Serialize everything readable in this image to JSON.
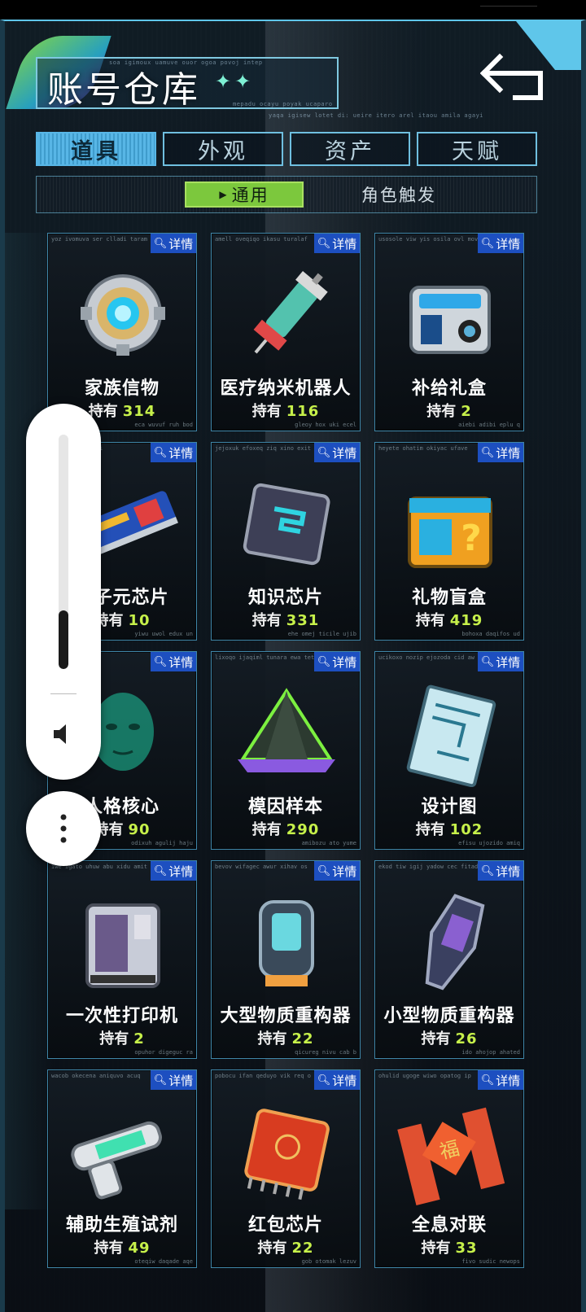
{
  "header": {
    "title": "账号仓库",
    "title_stars": "✦✦",
    "micro_lines": [
      "soa igimoux uamuve ouor ogoa povoj intep",
      "mepadu ocayu poyak ucaparo",
      "yaqa igisew lotet di: ueire itero arel itaou amila agayi"
    ]
  },
  "tabs": [
    {
      "label": "道具",
      "active": true
    },
    {
      "label": "外观",
      "active": false
    },
    {
      "label": "资产",
      "active": false
    },
    {
      "label": "天赋",
      "active": false
    }
  ],
  "subtabs": [
    {
      "label": "通用",
      "active": true
    },
    {
      "label": "角色触发",
      "active": false
    }
  ],
  "detail_label": "详情",
  "hold_label": "持有",
  "items": [
    {
      "name": "家族信物",
      "count": "314",
      "icon": "family-token-icon",
      "code_top": "yoz ivomuva ser clladi taram",
      "code_bot": "eca wuvuf ruh bod"
    },
    {
      "name": "医疗纳米机器人",
      "count": "116",
      "icon": "medical-nanobot-icon",
      "code_top": "amell oveqiqo ikasu turalaf",
      "code_bot": "gleoy hox uki ecel"
    },
    {
      "name": "补给礼盒",
      "count": "2",
      "icon": "supply-box-icon",
      "code_top": "usosole viw yis osila ovl mov",
      "code_bot": "aiebi adibi eplu q"
    },
    {
      "name": "量子元芯片",
      "count": "10",
      "icon": "quantum-chip-icon",
      "code_top": "zo uqemu aju oi",
      "code_bot": "yiwu uwol edux un"
    },
    {
      "name": "知识芯片",
      "count": "331",
      "icon": "knowledge-chip-icon",
      "code_top": "jejoxuk efoxeq ziq xino exit",
      "code_bot": "ehe omej ticile ujib"
    },
    {
      "name": "礼物盲盒",
      "count": "419",
      "icon": "mystery-gift-box-icon",
      "code_top": "heyete ohatim okiyac ufave",
      "code_bot": "bohoxa daqifos ud"
    },
    {
      "name": "人格核心",
      "count": "90",
      "icon": "persona-core-icon",
      "code_top": "sabi orusor it",
      "code_bot": "odixuh agulij haju"
    },
    {
      "name": "模因样本",
      "count": "290",
      "icon": "meme-sample-pyramid-icon",
      "code_top": "lixoqo ijaqiml tunara ewa tet",
      "code_bot": "amibozu ato yume"
    },
    {
      "name": "设计图",
      "count": "102",
      "icon": "blueprint-icon",
      "code_top": "ucikoxo nozip ejozoda cid aw",
      "code_bot": "efisu ujozido amiq"
    },
    {
      "name": "一次性打印机",
      "count": "2",
      "icon": "disposable-printer-icon",
      "code_top": "iwe igato uhuw abu xidu amit",
      "code_bot": "opuhor digeguc ra"
    },
    {
      "name": "大型物质重构器",
      "count": "22",
      "icon": "large-reconstructor-icon",
      "code_top": "bevov wifagec awur xihav os",
      "code_bot": "qicureg nivu cab b"
    },
    {
      "name": "小型物质重构器",
      "count": "26",
      "icon": "small-reconstructor-icon",
      "code_top": "ekod tiw igij yadow cec fitad",
      "code_bot": "ido ahojop ahated"
    },
    {
      "name": "辅助生殖试剂",
      "count": "49",
      "icon": "reagent-injector-icon",
      "code_top": "wacob okecena aniquvo acuq",
      "code_bot": "oteqiw daqade aqe"
    },
    {
      "name": "红包芯片",
      "count": "22",
      "icon": "red-envelope-chip-icon",
      "code_top": "pobocu ifan qeduyo vik req o",
      "code_bot": "gob otomak lezuv"
    },
    {
      "name": "全息对联",
      "count": "33",
      "icon": "hologram-couplets-icon",
      "code_top": "ohulid ugoge wiwo opatog ip",
      "code_bot": "fivo sudic newops"
    }
  ],
  "volume": {
    "level": 0.25
  },
  "colors": {
    "accent": "#5fc6ea",
    "active_tab": "#58b6e6",
    "subtab_active": "#7cc83d",
    "count": "#c6f04a",
    "detail": "#1d4fc0"
  }
}
